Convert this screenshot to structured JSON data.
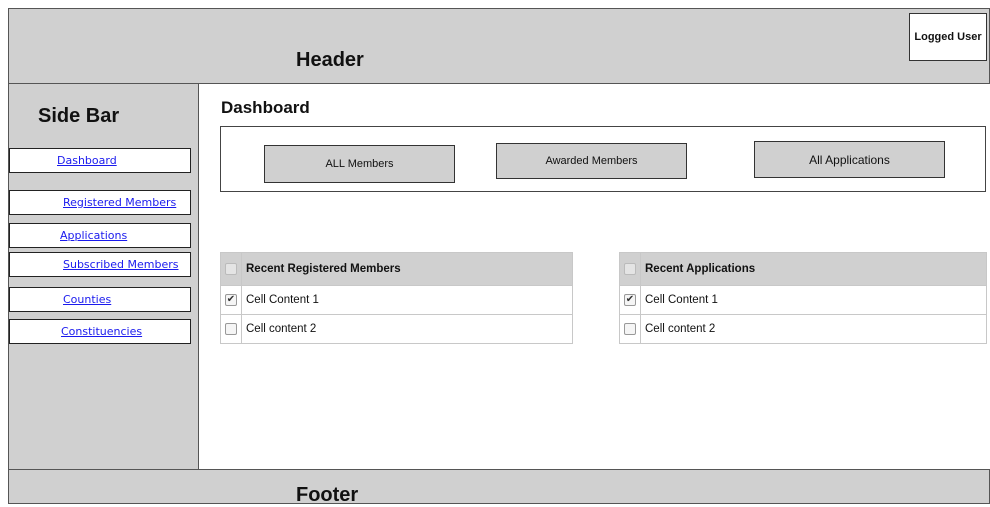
{
  "header": {
    "title": "Header",
    "user": "Logged User"
  },
  "sidebar": {
    "title": "Side Bar",
    "items": [
      {
        "label": "Dashboard"
      },
      {
        "label": "Registered Members"
      },
      {
        "label": "Applications"
      },
      {
        "label": "Subscribed Members"
      },
      {
        "label": "Counties"
      },
      {
        "label": "Constituencies"
      }
    ]
  },
  "main": {
    "title": "Dashboard",
    "stats": {
      "all_members": "ALL Members",
      "awarded_members": "Awarded Members",
      "all_applications": "All Applications"
    },
    "recent_members": {
      "header": "Recent Registered Members",
      "rows": [
        {
          "text": "Cell Content 1",
          "checked": true
        },
        {
          "text": "Cell content 2",
          "checked": false
        }
      ]
    },
    "recent_applications": {
      "header": "Recent Applications",
      "rows": [
        {
          "text": "Cell Content 1",
          "checked": true
        },
        {
          "text": "Cell content 2",
          "checked": false
        }
      ]
    }
  },
  "footer": {
    "title": "Footer"
  },
  "colors": {
    "panel_gray": "#d0d0d0",
    "link_blue": "#1a1aee"
  },
  "icons": {
    "checked": "checkmark-icon"
  }
}
